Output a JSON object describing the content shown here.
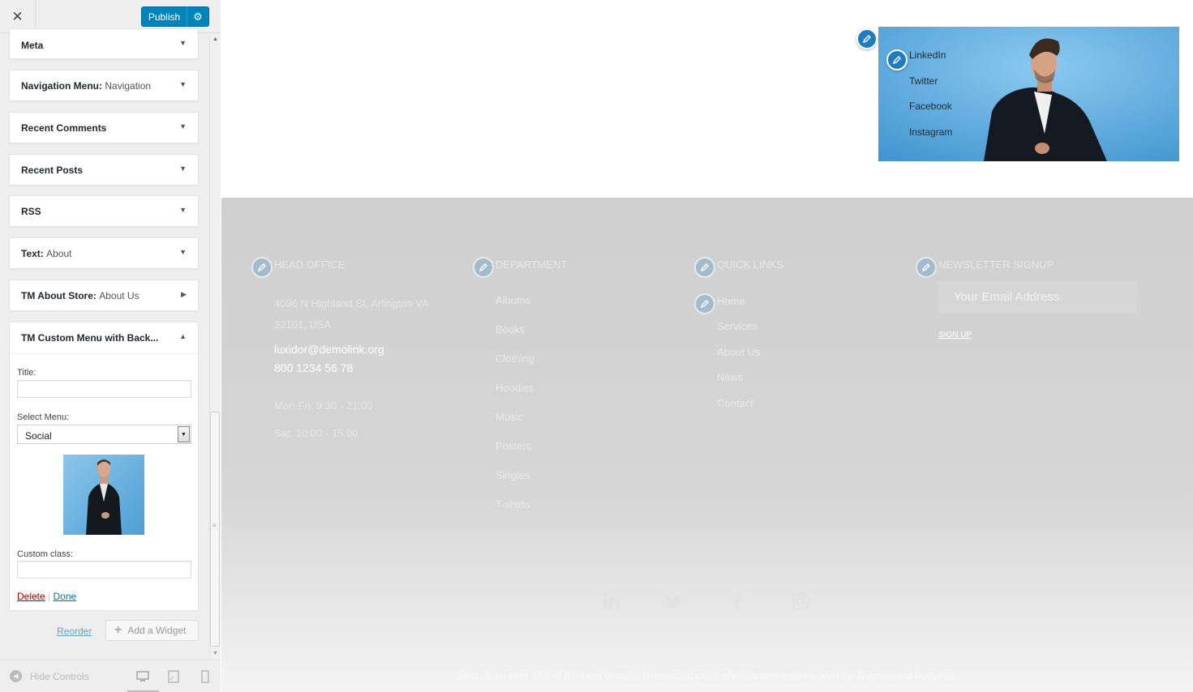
{
  "topbar": {
    "publish_label": "Publish"
  },
  "sidebar": {
    "widgets": [
      {
        "title": "Meta",
        "subtitle": ""
      },
      {
        "title": "Navigation Menu:",
        "subtitle": "Navigation"
      },
      {
        "title": "Recent Comments",
        "subtitle": ""
      },
      {
        "title": "Recent Posts",
        "subtitle": ""
      },
      {
        "title": "RSS",
        "subtitle": ""
      },
      {
        "title": "Text:",
        "subtitle": "About"
      },
      {
        "title": "TM About Store:",
        "subtitle": "About Us"
      }
    ],
    "expanded_widget": {
      "title": "TM Custom Menu with Back...",
      "title_label": "Title:",
      "title_value": "",
      "select_label": "Select Menu:",
      "select_value": "Social",
      "custom_class_label": "Custom class:",
      "custom_class_value": "",
      "delete_label": "Delete",
      "separator": "|",
      "done_label": "Done"
    },
    "reorder_label": "Reorder",
    "add_widget_label": "Add a Widget",
    "hide_controls_label": "Hide Controls"
  },
  "preview": {
    "banner_links": [
      "LinkedIn",
      "Twitter",
      "Facebook",
      "Instagram"
    ],
    "footer": {
      "head_office": {
        "title": "HEAD OFFICE",
        "address_line1": "4096 N Highland St, Arlington VA",
        "address_line2": "32101, USA",
        "email": "luxidor@demolink.org",
        "phone": "800 1234 56 78",
        "hours1": "Mon-Fri: 9:30 - 21:00",
        "hours2": "Sat: 10:00 - 15:00"
      },
      "department": {
        "title": "DEPARTMENT",
        "items": [
          "Albums",
          "Books",
          "Clothing",
          "Hoodies",
          "Music",
          "Posters",
          "Singles",
          "T-shirts"
        ]
      },
      "quick_links": {
        "title": "QUICK LINKS",
        "items": [
          "Home",
          "Services",
          "About Us",
          "News",
          "Contact"
        ]
      },
      "newsletter": {
        "title": "NEWSLETTER SIGNUP",
        "placeholder": "Your Email Address",
        "signup_label": "SIGN UP"
      },
      "copyright": "Shop from over 950 of the best brands. Dresses, tops, T-shirts and sneakers, jewelry, lingerie and bodysuit."
    }
  },
  "colors": {
    "accent": "#0085ba",
    "edit_pen": "#1e7cc0",
    "banner_bg": "#5aaee0"
  }
}
